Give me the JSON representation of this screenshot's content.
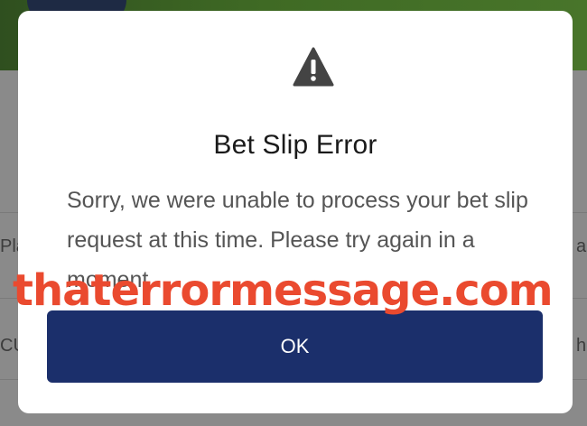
{
  "background": {
    "partial_left_1": "Pla",
    "partial_left_2": "CU",
    "partial_right_1": "a",
    "partial_right_2": "he"
  },
  "dialog": {
    "icon": "warning-triangle-icon",
    "title": "Bet Slip Error",
    "message": "Sorry, we were unable to process your bet slip request at this time. Please try again in a moment",
    "ok_label": "OK"
  },
  "watermark": "thaterrormessage.com",
  "colors": {
    "button": "#1b2f6b",
    "watermark": "#ea4a2f",
    "icon": "#444444"
  }
}
